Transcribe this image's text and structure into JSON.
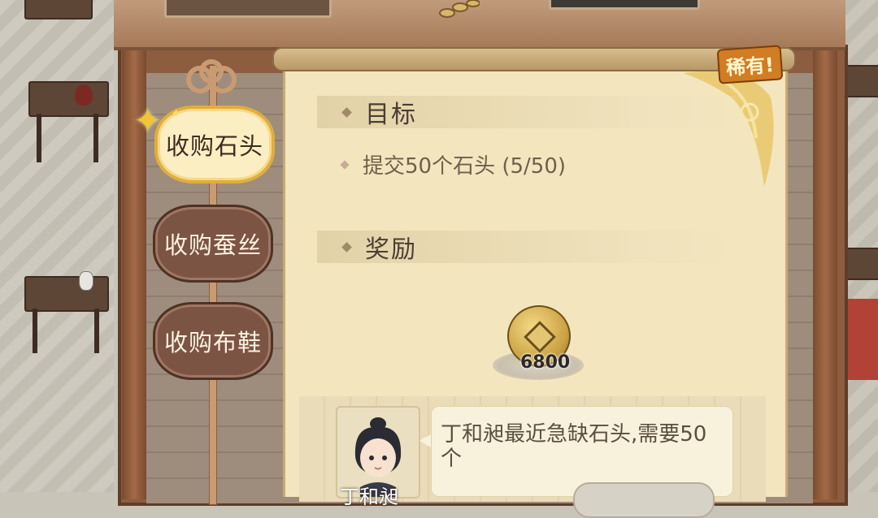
{
  "quest_tabs": [
    {
      "label": "收购石头",
      "active": true
    },
    {
      "label": "收购蚕丝",
      "active": false
    },
    {
      "label": "收购布鞋",
      "active": false
    }
  ],
  "badge": {
    "rare": "稀有!"
  },
  "objective": {
    "title": "目标",
    "line": "提交50个石头 (5/50)"
  },
  "reward": {
    "title": "奖励",
    "item_icon": "copper-coin-icon",
    "amount": "6800"
  },
  "dialog": {
    "text": "丁和昶最近急缺石头,需要50个",
    "npc_name": "丁和昶"
  },
  "colors": {
    "accent_gold": "#e1ae3c",
    "tab_inactive": "#7c5443",
    "scroll_paper": "#f3e6be",
    "rare_orange": "#d27c23"
  }
}
